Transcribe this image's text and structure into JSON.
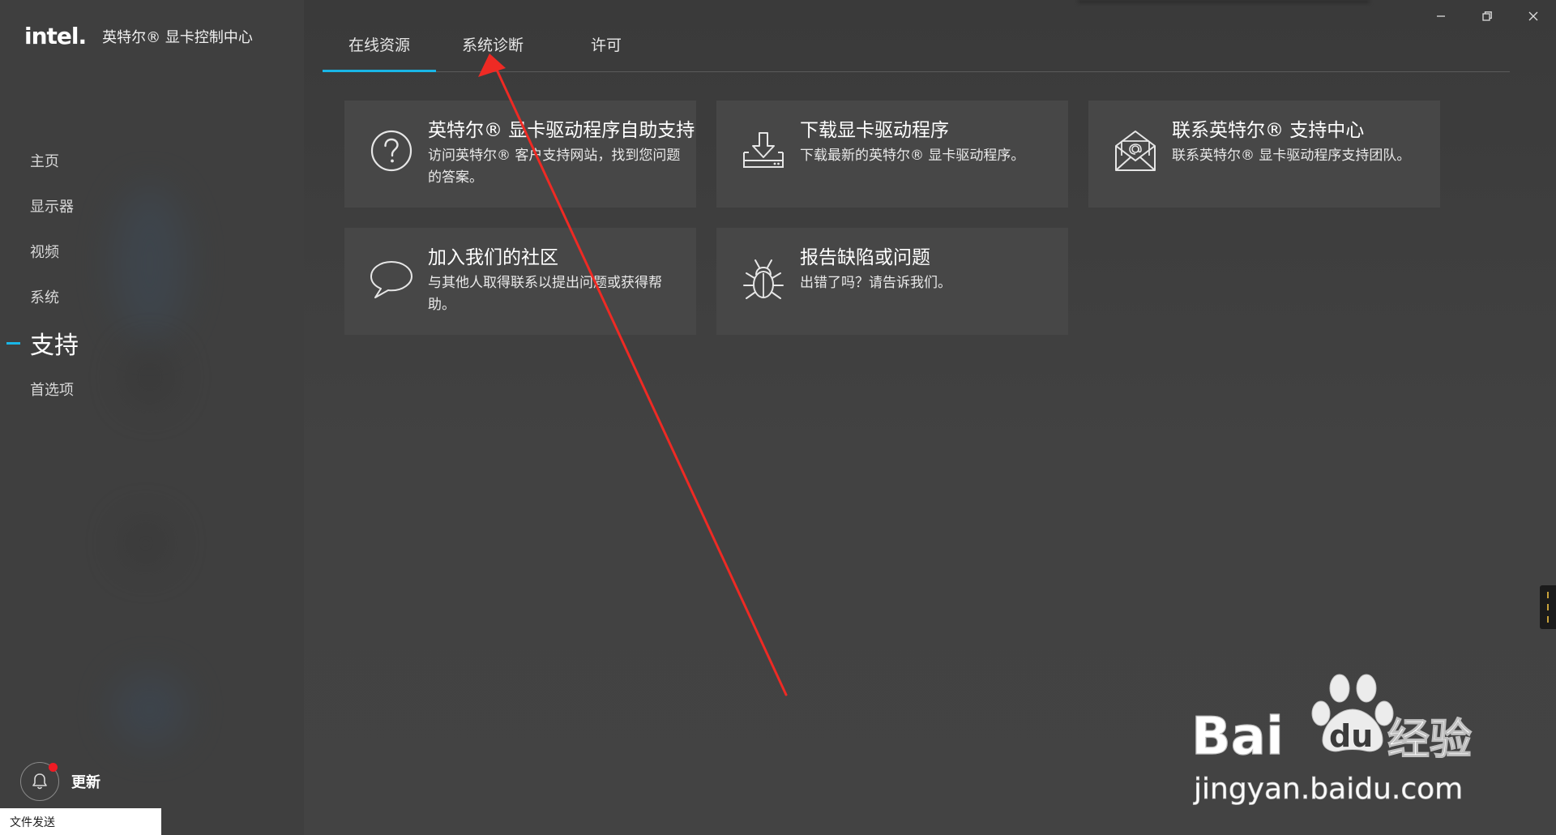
{
  "app": {
    "logo_text": "intel.",
    "title": "英特尔® 显卡控制中心"
  },
  "sidebar": {
    "items": [
      {
        "label": "主页",
        "icon": "none",
        "active": false
      },
      {
        "label": "显示器",
        "icon": "none",
        "active": false
      },
      {
        "label": "视频",
        "icon": "none",
        "active": false
      },
      {
        "label": "系统",
        "icon": "none",
        "active": false
      },
      {
        "label": "支持",
        "icon": "none",
        "active": true
      },
      {
        "label": "首选项",
        "icon": "none",
        "active": false
      }
    ],
    "update_label": "更新",
    "file_send_label": "文件发送"
  },
  "window": {
    "controls": [
      "minimize-icon",
      "restore-icon",
      "close-icon"
    ]
  },
  "tabs": [
    {
      "label": "在线资源",
      "active": true
    },
    {
      "label": "系统诊断",
      "active": false
    },
    {
      "label": "许可",
      "active": false
    }
  ],
  "cards": [
    {
      "title": "英特尔® 显卡驱动程序自助支持",
      "desc": "访问英特尔® 客户支持网站，找到您问题的答案。",
      "icon": "question-circle-icon"
    },
    {
      "title": "下载显卡驱动程序",
      "desc": "下载最新的英特尔® 显卡驱动程序。",
      "icon": "download-tray-icon"
    },
    {
      "title": "联系英特尔® 支持中心",
      "desc": "联系英特尔® 显卡驱动程序支持团队。",
      "icon": "envelope-at-icon"
    },
    {
      "title": "加入我们的社区",
      "desc": "与其他人取得联系以提出问题或获得帮助。",
      "icon": "speech-bubble-icon"
    },
    {
      "title": "报告缺陷或问题",
      "desc": "出错了吗？请告诉我们。",
      "icon": "bug-icon"
    }
  ],
  "watermark": {
    "brand": "Bai",
    "brand_du": "du",
    "brand_suffix": "经验",
    "url": "jingyan.baidu.com"
  },
  "colors": {
    "accent": "#19b6e6",
    "annotation_arrow": "#ee2a24",
    "notification_dot": "#ee1b24"
  }
}
